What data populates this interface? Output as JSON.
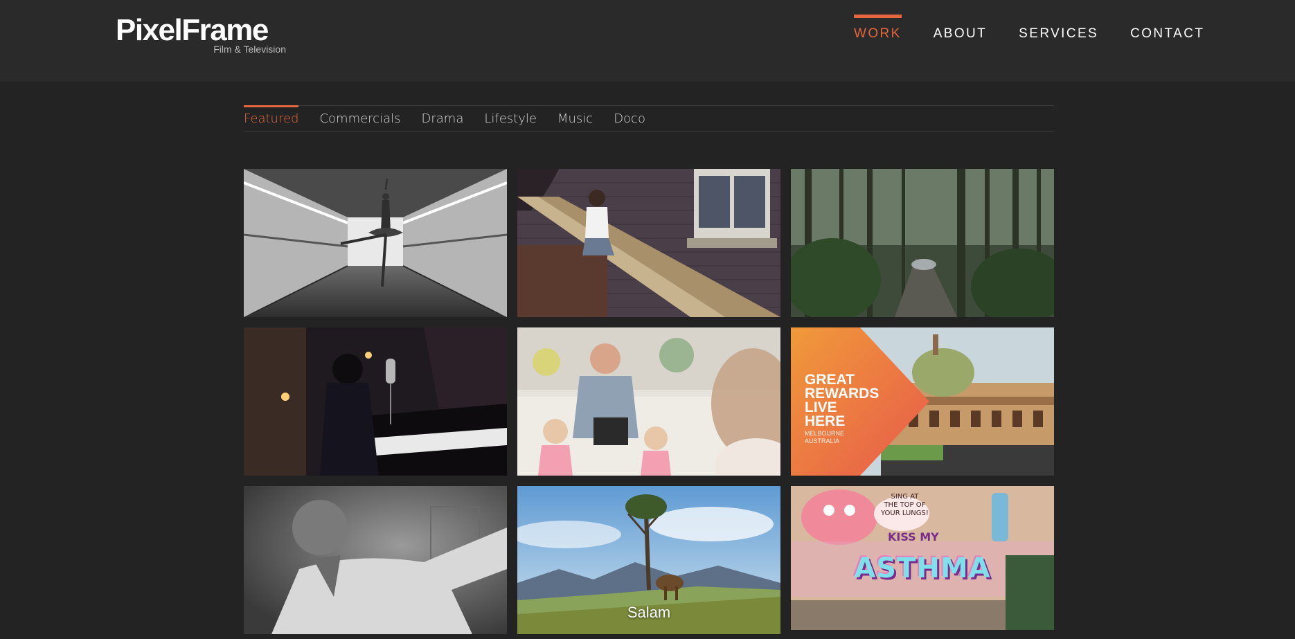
{
  "brand": {
    "name": "PixelFrame",
    "tagline": "Film & Television"
  },
  "main_nav": [
    {
      "label": "WORK",
      "active": true
    },
    {
      "label": "ABOUT",
      "active": false
    },
    {
      "label": "SERVICES",
      "active": false
    },
    {
      "label": "CONTACT",
      "active": false
    }
  ],
  "category_nav": [
    {
      "label": "Featured",
      "active": true
    },
    {
      "label": "Commercials",
      "active": false
    },
    {
      "label": "Drama",
      "active": false
    },
    {
      "label": "Lifestyle",
      "active": false
    },
    {
      "label": "Music",
      "active": false
    },
    {
      "label": "Doco",
      "active": false
    }
  ],
  "tiles": [
    {
      "id": "tile-ballet-corridor",
      "caption": ""
    },
    {
      "id": "tile-woman-stairs",
      "caption": ""
    },
    {
      "id": "tile-forest-road",
      "caption": ""
    },
    {
      "id": "tile-pianist-singer",
      "caption": ""
    },
    {
      "id": "tile-family-kitchen",
      "caption": ""
    },
    {
      "id": "tile-melbourne-station",
      "caption": "",
      "promo_lines": "GREAT\nREWARDS\nLIVE\nHERE",
      "promo_sub": "MELBOURNE\nAUSTRALIA"
    },
    {
      "id": "tile-man-portrait",
      "caption": ""
    },
    {
      "id": "tile-mountain-tree",
      "caption": "Salam"
    },
    {
      "id": "tile-graffiti-wall",
      "caption": "",
      "graffiti_main": "ASTHMA",
      "graffiti_top": "SING AT\nTHE TOP OF\nYOUR LUNGS!",
      "graffiti_small": "KISS MY"
    }
  ],
  "colors": {
    "accent": "#e8663d",
    "header_bg": "#2a2a2a",
    "page_bg": "#232323"
  }
}
